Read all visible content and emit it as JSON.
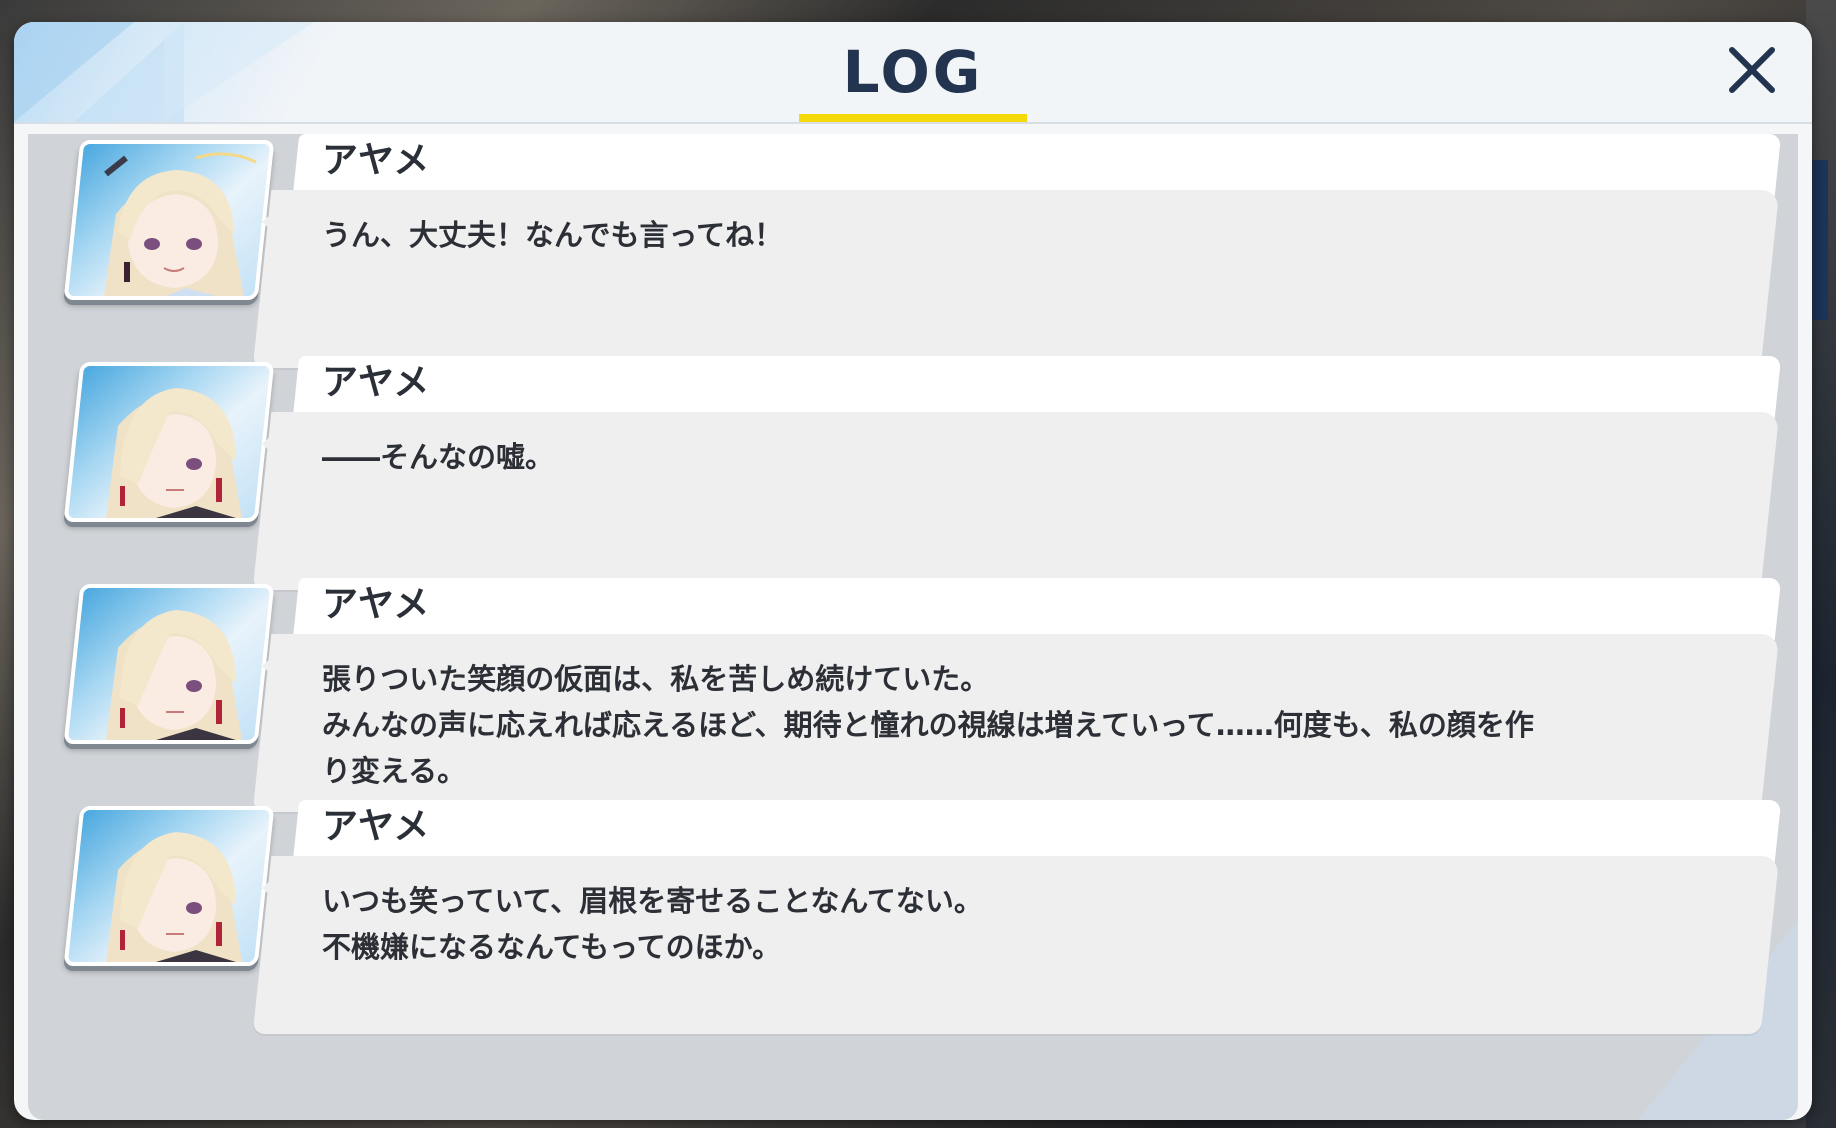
{
  "header": {
    "title": "LOG",
    "close_icon": "close-icon"
  },
  "entries": [
    {
      "speaker": "アヤメ",
      "avatar": "character-portrait-smiling",
      "text": "うん、大丈夫！なんでも言ってね！"
    },
    {
      "speaker": "アヤメ",
      "avatar": "character-portrait-serious",
      "text": "――そんなの嘘。"
    },
    {
      "speaker": "アヤメ",
      "avatar": "character-portrait-serious",
      "text": "張りついた笑顔の仮面は、私を苦しめ続けていた。\nみんなの声に応えれば応えるほど、期待と憧れの視線は増えていって……何度も、私の顔を作\nり変える。"
    },
    {
      "speaker": "アヤメ",
      "avatar": "character-portrait-serious",
      "text": "いつも笑っていて、眉根を寄せることなんてない。\n不機嫌になるなんてもってのほか。"
    }
  ],
  "colors": {
    "title": "#22344f",
    "title_underline": "#f5d90b",
    "name_card": "#ffffff",
    "message_card": "#efeff0",
    "log_background": "#d0d3d7"
  }
}
